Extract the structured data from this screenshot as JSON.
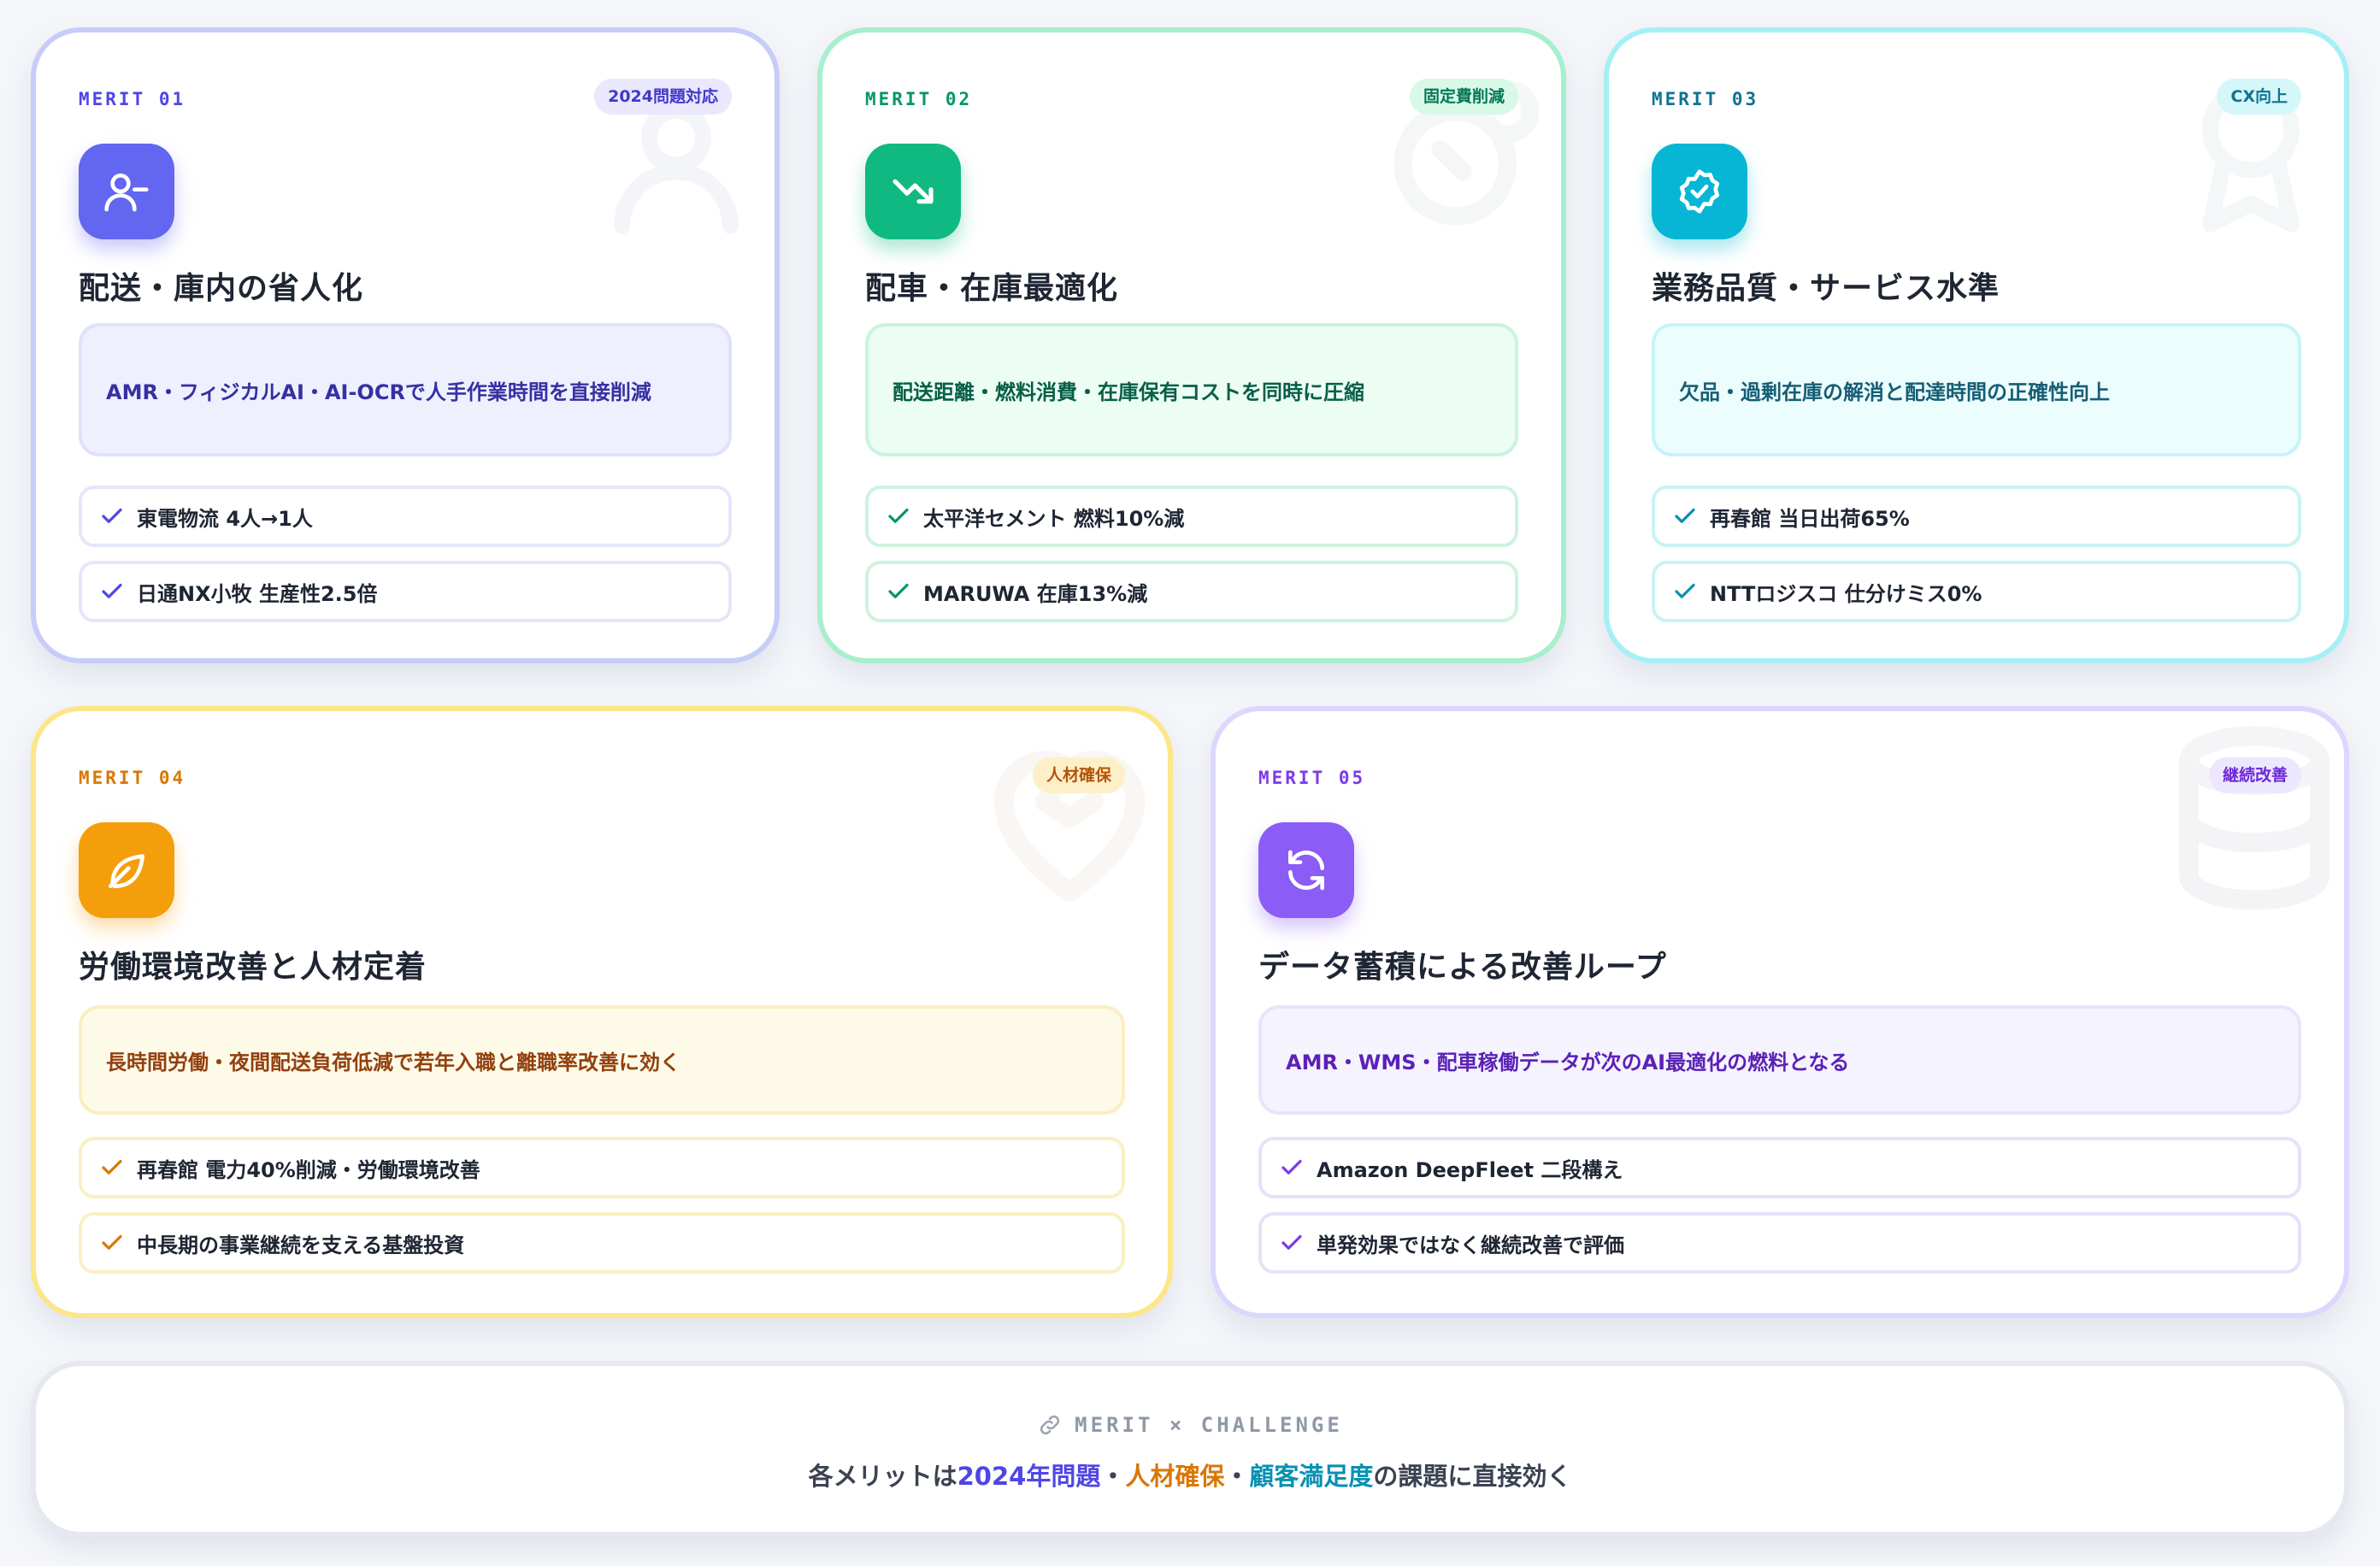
{
  "cards": [
    {
      "merit": "MERIT 01",
      "badge": "2024問題対応",
      "icon": "user-minus-icon",
      "title": "配送・庫内の省人化",
      "desc": "AMR・フィジカルAI・AI-OCRで人手作業時間を直接削減",
      "checks": [
        "東電物流 4人→1人",
        "日通NX小牧 生産性2.5倍"
      ],
      "colors": {
        "accent": "#4f46e5",
        "icon_bg": "#6366f1",
        "border": "#c7cdf8"
      }
    },
    {
      "merit": "MERIT 02",
      "badge": "固定費削減",
      "icon": "trending-down-icon",
      "title": "配車・在庫最適化",
      "desc": "配送距離・燃料消費・在庫保有コストを同時に圧縮",
      "checks": [
        "太平洋セメント 燃料10%減",
        "MARUWA 在庫13%減"
      ],
      "colors": {
        "accent": "#059669",
        "icon_bg": "#10b981",
        "border": "#a7efcd"
      }
    },
    {
      "merit": "MERIT 03",
      "badge": "CX向上",
      "icon": "badge-check-icon",
      "title": "業務品質・サービス水準",
      "desc": "欠品・過剰在庫の解消と配達時間の正確性向上",
      "checks": [
        "再春館 当日出荷65%",
        "NTTロジスコ 仕分けミス0%"
      ],
      "colors": {
        "accent": "#0e7490",
        "icon_bg": "#06b6d4",
        "border": "#a5f0f5"
      }
    },
    {
      "merit": "MERIT 04",
      "badge": "人材確保",
      "icon": "leaf-icon",
      "title": "労働環境改善と人材定着",
      "desc": "長時間労働・夜間配送負荷低減で若年入職と離職率改善に効く",
      "checks": [
        "再春館 電力40%削減・労働環境改善",
        "中長期の事業継続を支える基盤投資"
      ],
      "colors": {
        "accent": "#d97706",
        "icon_bg": "#f59e0b",
        "border": "#fde68a"
      }
    },
    {
      "merit": "MERIT 05",
      "badge": "継続改善",
      "icon": "refresh-icon",
      "title": "データ蓄積による改善ループ",
      "desc": "AMR・WMS・配車稼働データが次のAI最適化の燃料となる",
      "checks": [
        "Amazon DeepFleet 二段構え",
        "単発効果ではなく継続改善で評価"
      ],
      "colors": {
        "accent": "#7c3aed",
        "icon_bg": "#8b5cf6",
        "border": "#ddd6fe"
      }
    }
  ],
  "bottom": {
    "label": "MERIT × CHALLENGE",
    "sentence_prefix": "各メリットは",
    "hl1": "2024年問題",
    "sep1": "・",
    "hl2": "人材確保",
    "sep2": "・",
    "hl3": "顧客満足度",
    "sentence_suffix": "の課題に直接効く"
  }
}
